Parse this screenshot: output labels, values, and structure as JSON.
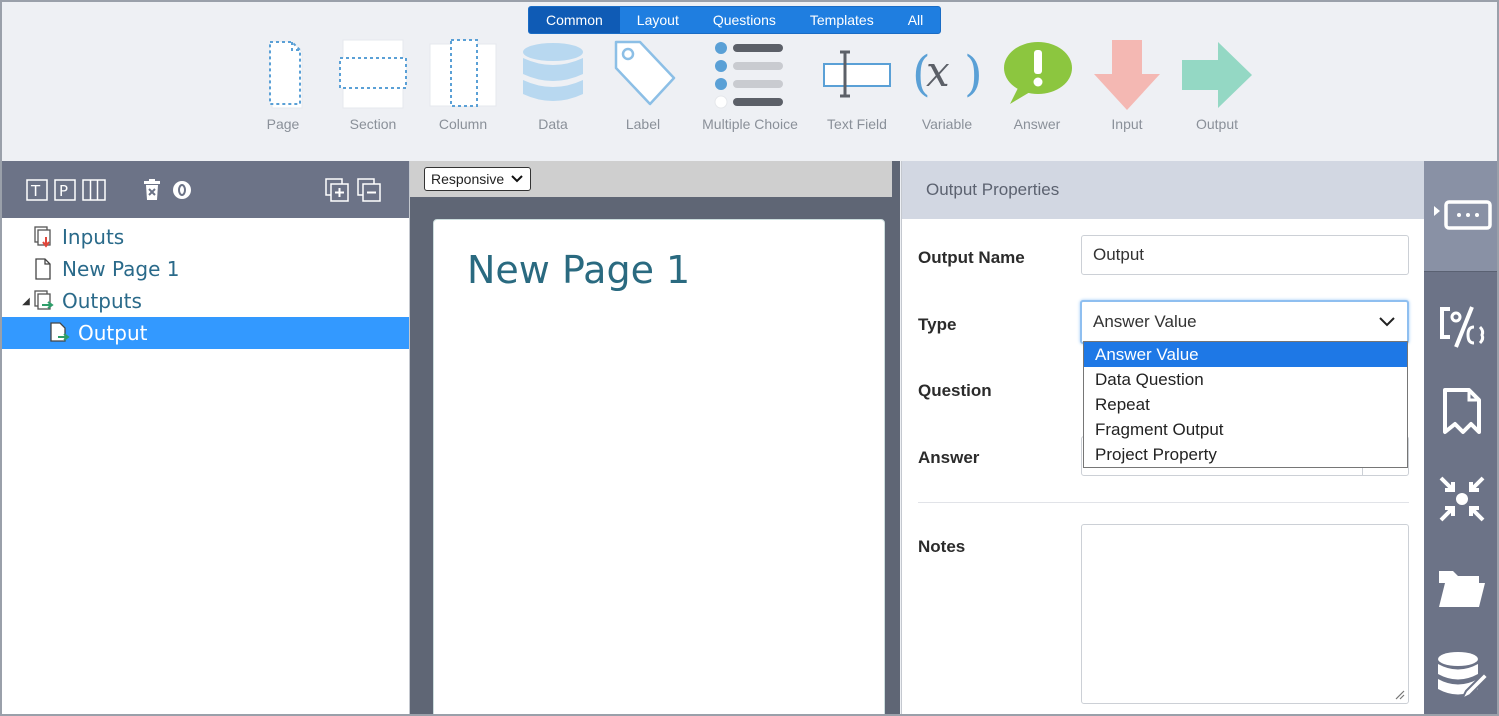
{
  "ribbon": {
    "tabs": [
      "Common",
      "Layout",
      "Questions",
      "Templates",
      "All"
    ],
    "tools": [
      {
        "label": "Page",
        "icon": "page-icon"
      },
      {
        "label": "Section",
        "icon": "section-icon"
      },
      {
        "label": "Column",
        "icon": "column-icon"
      },
      {
        "label": "Data",
        "icon": "database-icon"
      },
      {
        "label": "Label",
        "icon": "tag-icon"
      },
      {
        "label": "Multiple Choice",
        "icon": "list-icon"
      },
      {
        "label": "Text Field",
        "icon": "text-cursor-icon"
      },
      {
        "label": "Variable",
        "icon": "variable-x-icon"
      },
      {
        "label": "Answer",
        "icon": "speech-exclamation-icon"
      },
      {
        "label": "Input",
        "icon": "arrow-down-icon"
      },
      {
        "label": "Output",
        "icon": "arrow-right-icon"
      }
    ]
  },
  "left": {
    "toolbar_icons": [
      "text-block-icon",
      "page-block-icon",
      "columns-block-icon",
      "delete-icon",
      "zero-badge-icon",
      "expand-all-icon",
      "collapse-all-icon"
    ],
    "tree": [
      {
        "label": "Inputs",
        "level": 0,
        "icon": "inputs-icon"
      },
      {
        "label": "New Page 1",
        "level": 0,
        "icon": "page-icon"
      },
      {
        "label": "Outputs",
        "level": 0,
        "icon": "outputs-icon",
        "expanded": true
      },
      {
        "label": "Output",
        "level": 1,
        "icon": "output-icon",
        "selected": true
      }
    ]
  },
  "center": {
    "view_mode": "Responsive",
    "page_title": "New Page 1"
  },
  "props": {
    "header": "Output Properties",
    "output_name_label": "Output Name",
    "output_name_value": "Output",
    "type_label": "Type",
    "type_value": "Answer Value",
    "question_label": "Question",
    "answer_label": "Answer",
    "notes_label": "Notes",
    "type_options": [
      "Answer Value",
      "Data Question",
      "Repeat",
      "Fragment Output",
      "Project Property"
    ]
  },
  "rail": {
    "icons": [
      "textbox-dots-icon",
      "code-percent-icon",
      "bookmark-page-icon",
      "compress-arrows-icon",
      "folder-icon",
      "database-edit-icon"
    ]
  },
  "colors": {
    "accent": "#1f7ee0",
    "selected_row": "#3399ff",
    "dark_toolbar": "#6c7387",
    "title_teal": "#2a6a80"
  }
}
